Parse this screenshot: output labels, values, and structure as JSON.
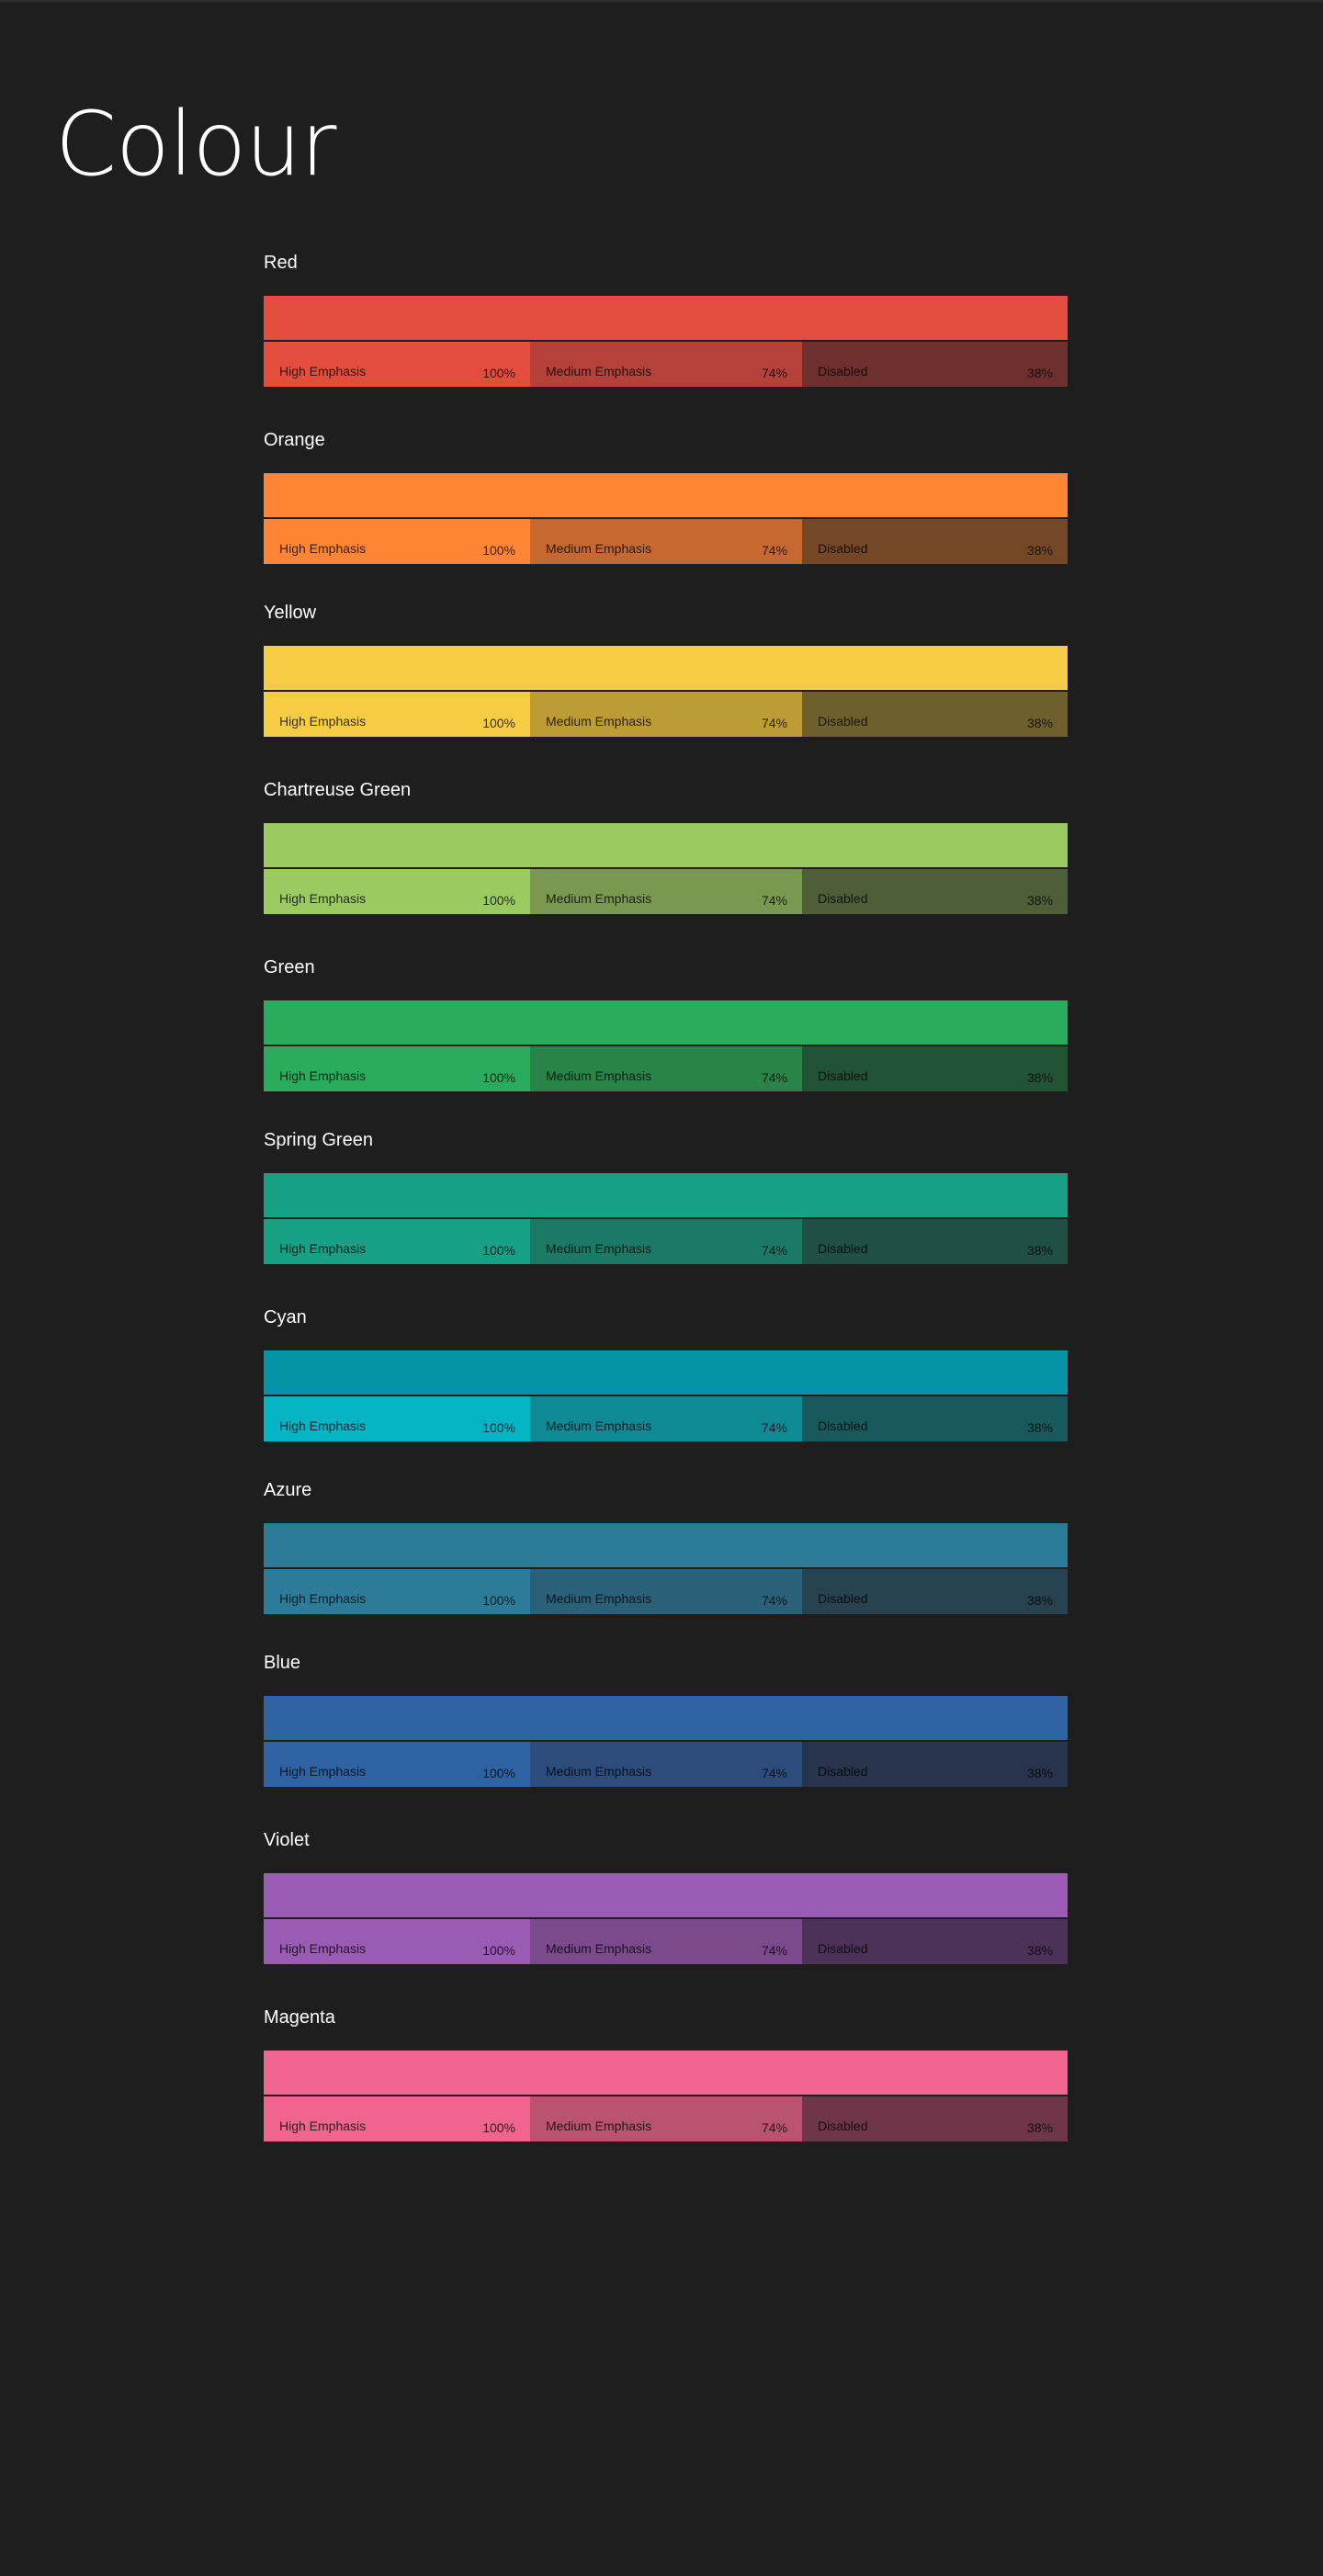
{
  "page": {
    "title": "Colour"
  },
  "tone_labels": {
    "high": "High Emphasis",
    "medium": "Medium Emphasis",
    "disabled": "Disabled"
  },
  "tone_percents": {
    "high": "100%",
    "medium": "74%",
    "disabled": "38%"
  },
  "colors": [
    {
      "name": "Red",
      "base": "#e44d3e",
      "high": "#e44d3e",
      "medium": "#b4413a",
      "disabled": "#6d302e"
    },
    {
      "name": "Orange",
      "base": "#fe8533",
      "high": "#fe8533",
      "medium": "#c66830",
      "disabled": "#744727"
    },
    {
      "name": "Yellow",
      "base": "#f5cc44",
      "high": "#f5cc44",
      "medium": "#bd9b35",
      "disabled": "#6f5f2c"
    },
    {
      "name": "Chartreuse Green",
      "base": "#9bca61",
      "high": "#9bca61",
      "medium": "#7a984f",
      "disabled": "#4e5e39"
    },
    {
      "name": "Green",
      "base": "#29ad5c",
      "high": "#29ad5c",
      "medium": "#288449",
      "disabled": "#235335"
    },
    {
      "name": "Spring Green",
      "base": "#17a084",
      "high": "#17a084",
      "medium": "#1b7a66",
      "disabled": "#1f4f45"
    },
    {
      "name": "Cyan",
      "base": "#0494a6",
      "high": "#04b4c5",
      "medium": "#0e8a95",
      "disabled": "#18595d"
    },
    {
      "name": "Azure",
      "base": "#2c7b98",
      "high": "#2c7b98",
      "medium": "#2b6178",
      "disabled": "#284250"
    },
    {
      "name": "Blue",
      "base": "#2e62a2",
      "high": "#2e62a2",
      "medium": "#2c4c7c",
      "disabled": "#27344b"
    },
    {
      "name": "Violet",
      "base": "#9a5bb5",
      "high": "#9a5bb5",
      "medium": "#7a4a8d",
      "disabled": "#4c3257"
    },
    {
      "name": "Magenta",
      "base": "#ef6590",
      "high": "#ef6590",
      "medium": "#ba536f",
      "disabled": "#6f3548"
    }
  ]
}
